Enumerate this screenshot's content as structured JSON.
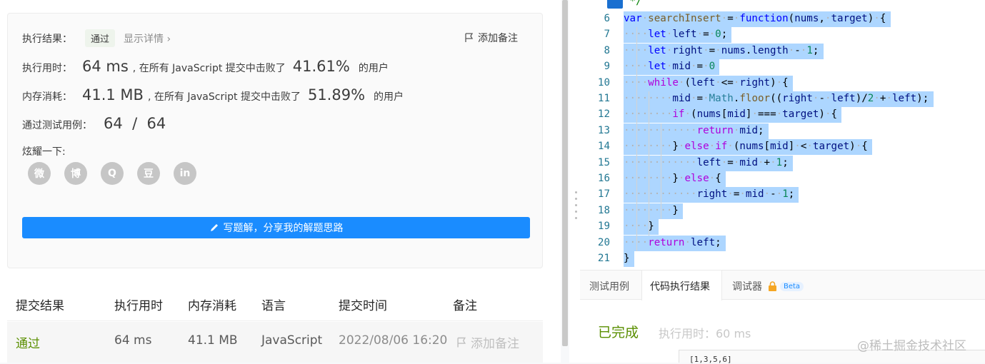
{
  "result": {
    "label": "执行结果：",
    "status": "通过",
    "details": "显示详情 ›",
    "add_note": "添加备注",
    "runtime_label": "执行用时：",
    "runtime_value": "64 ms",
    "runtime_text": ", 在所有 JavaScript 提交中击败了",
    "runtime_percent": "41.61%",
    "runtime_suffix": "的用户",
    "memory_label": "内存消耗：",
    "memory_value": "41.1 MB",
    "memory_text": ", 在所有 JavaScript 提交中击败了",
    "memory_percent": "51.89%",
    "memory_suffix": "的用户",
    "tests_label": "通过测试用例：",
    "tests_value": "64  /  64",
    "share_label": "炫耀一下:",
    "share_icons": [
      "wechat-icon",
      "weibo-icon",
      "qq-icon",
      "douban-icon",
      "linkedin-icon"
    ],
    "share_glyphs": [
      "微",
      "博",
      "Q",
      "豆",
      "in"
    ],
    "solution_button": "写题解，分享我的解题思路"
  },
  "table": {
    "headers": [
      "提交结果",
      "执行用时",
      "内存消耗",
      "语言",
      "提交时间",
      "备注"
    ],
    "row": [
      "通过",
      "64 ms",
      "41.1 MB",
      "JavaScript",
      "2022/08/06 16:20",
      "添加备注"
    ]
  },
  "editor": {
    "top_comment": " */",
    "lines": [
      {
        "n": "6",
        "code": "var searchInsert = function(nums, target) {"
      },
      {
        "n": "7",
        "code": "    let left = 0;"
      },
      {
        "n": "8",
        "code": "    let right = nums.length - 1;"
      },
      {
        "n": "9",
        "code": "    let mid = 0"
      },
      {
        "n": "10",
        "code": "    while (left <= right) {"
      },
      {
        "n": "11",
        "code": "        mid = Math.floor((right - left)/2 + left);"
      },
      {
        "n": "12",
        "code": "        if (nums[mid] === target) {"
      },
      {
        "n": "13",
        "code": "            return mid;"
      },
      {
        "n": "14",
        "code": "        } else if (nums[mid] < target) {"
      },
      {
        "n": "15",
        "code": "            left = mid + 1;"
      },
      {
        "n": "16",
        "code": "        } else {"
      },
      {
        "n": "17",
        "code": "            right = mid - 1;"
      },
      {
        "n": "18",
        "code": "        }"
      },
      {
        "n": "19",
        "code": "    }"
      },
      {
        "n": "20",
        "code": "    return left;"
      },
      {
        "n": "21",
        "code": "}"
      }
    ]
  },
  "bottom_panel": {
    "tabs": [
      "测试用例",
      "代码执行结果",
      "调试器"
    ],
    "beta": "Beta",
    "status": "已完成",
    "time": "执行用时：60 ms",
    "output": "[1,3,5,6]"
  },
  "watermark": "@稀土掘金技术社区",
  "colors": {
    "accent": "#1a8cff",
    "success": "#5a8f00",
    "selection": "#add6ff"
  }
}
